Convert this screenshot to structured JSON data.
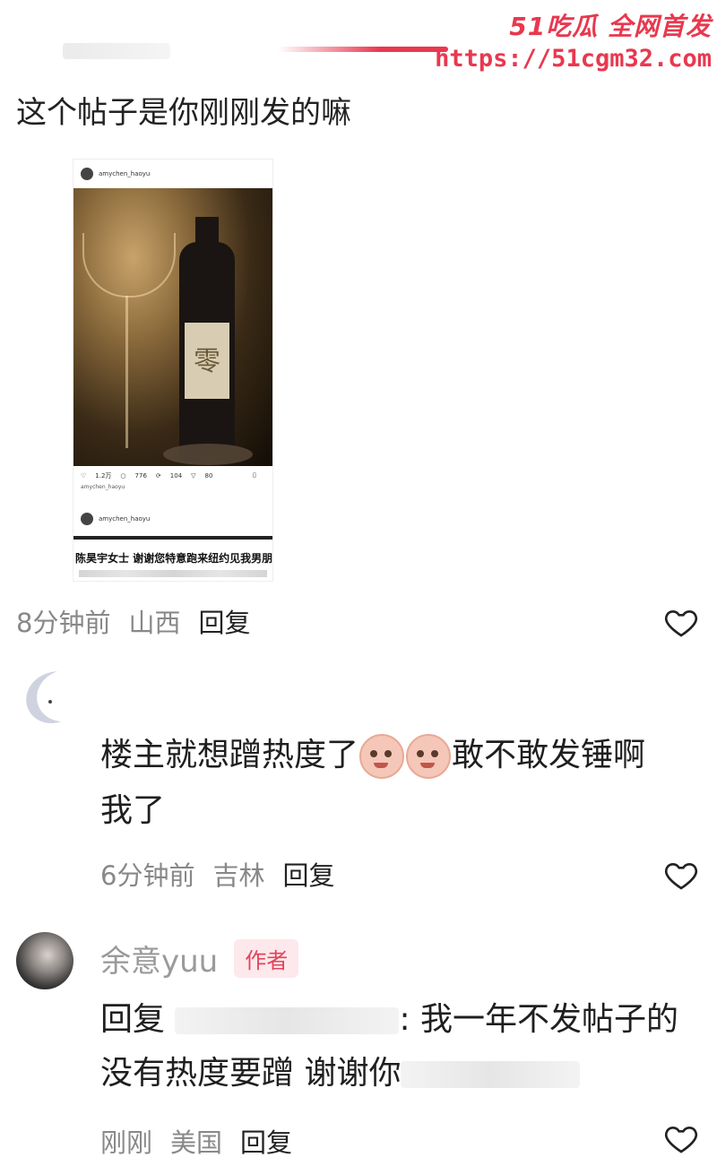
{
  "watermark": {
    "brand": "51吃瓜 全网首发",
    "url": "https://51cgm32.com"
  },
  "post": {
    "text": "这个帖子是你刚刚发的嘛",
    "screenshot": {
      "username": "amychen_haoyu",
      "stats": [
        "1.2万",
        "776",
        "104",
        "80"
      ],
      "caption": "amychen_haoyu",
      "username2": "amychen_haoyu",
      "bottom_text": "陈昊宇女士 谢谢您特意跑来纽约见我男朋友"
    },
    "meta": {
      "time": "8分钟前",
      "location": "山西",
      "reply": "回复"
    }
  },
  "comment2": {
    "line1": "楼主就想蹭热度了",
    "line1_after": "敢不敢发锤啊",
    "line2": "我了",
    "meta": {
      "time": "6分钟前",
      "location": "吉林",
      "reply": "回复"
    }
  },
  "comment3": {
    "author": "余意yuu",
    "badge": "作者",
    "reply_prefix": "回复",
    "text_part": ": 我一年不发帖子的",
    "line2": "没有热度要蹭 谢谢你",
    "meta": {
      "time": "刚刚",
      "location": "美国",
      "reply": "回复"
    }
  },
  "colors": {
    "accent": "#e8384f",
    "meta": "#888888"
  }
}
